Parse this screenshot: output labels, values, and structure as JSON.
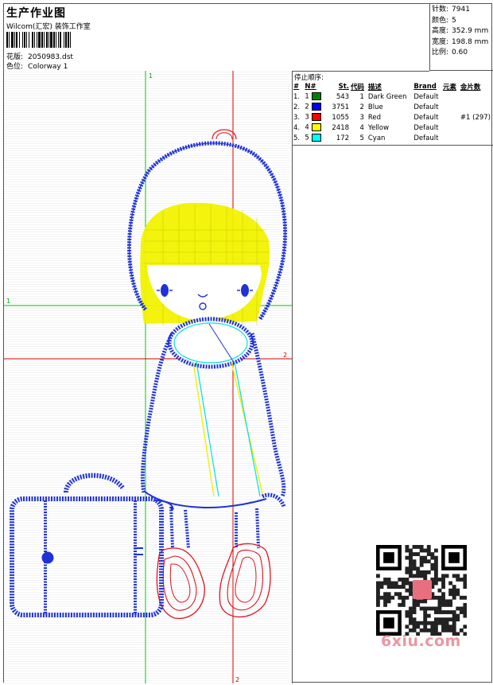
{
  "header": {
    "title": "生产作业图",
    "studio": "Wilcom(汇宏) 装饰工作室",
    "design_label": "花版:",
    "design_value": "2050983.dst",
    "colorway_label": "色位:",
    "colorway_value": "Colorway 1"
  },
  "specs": [
    {
      "label": "针数:",
      "value": "7941"
    },
    {
      "label": "颜色:",
      "value": "5"
    },
    {
      "label": "高度:",
      "value": "352.9 mm"
    },
    {
      "label": "宽度:",
      "value": "198.8 mm"
    },
    {
      "label": "比例:",
      "value": "0.60"
    }
  ],
  "stop_sequence": {
    "caption": "停止顺序:",
    "columns": [
      "#",
      "N#",
      "St.",
      "代码",
      "描述",
      "Brand",
      "元素",
      "金片数"
    ],
    "rows": [
      {
        "num": "1.",
        "n": "1",
        "color": "#008000",
        "st": "543",
        "code": "1",
        "desc": "Dark Green",
        "brand": "Default",
        "elem": "",
        "seq": ""
      },
      {
        "num": "2.",
        "n": "2",
        "color": "#0000ff",
        "st": "3751",
        "code": "2",
        "desc": "Blue",
        "brand": "Default",
        "elem": "",
        "seq": ""
      },
      {
        "num": "3.",
        "n": "3",
        "color": "#ff0000",
        "st": "1055",
        "code": "3",
        "desc": "Red",
        "brand": "Default",
        "elem": "",
        "seq": "#1 (297)"
      },
      {
        "num": "4.",
        "n": "4",
        "color": "#ffff00",
        "st": "2418",
        "code": "4",
        "desc": "Yellow",
        "brand": "Default",
        "elem": "",
        "seq": ""
      },
      {
        "num": "5.",
        "n": "5",
        "color": "#00ffff",
        "st": "172",
        "code": "5",
        "desc": "Cyan",
        "brand": "Default",
        "elem": "",
        "seq": ""
      }
    ]
  },
  "guides": {
    "green_label_top": "1",
    "green_label_left": "1",
    "red_label_right": "2",
    "red_label_bottom": "2"
  },
  "watermark": "6xiu.com",
  "colors": {
    "green_guide": "#00cc00",
    "red_guide": "#dd0000",
    "blue_stitch": "#1e32d8",
    "red_stitch": "#e0141e",
    "yellow_stitch": "#f0f000",
    "cyan_stitch": "#00e0e0"
  }
}
